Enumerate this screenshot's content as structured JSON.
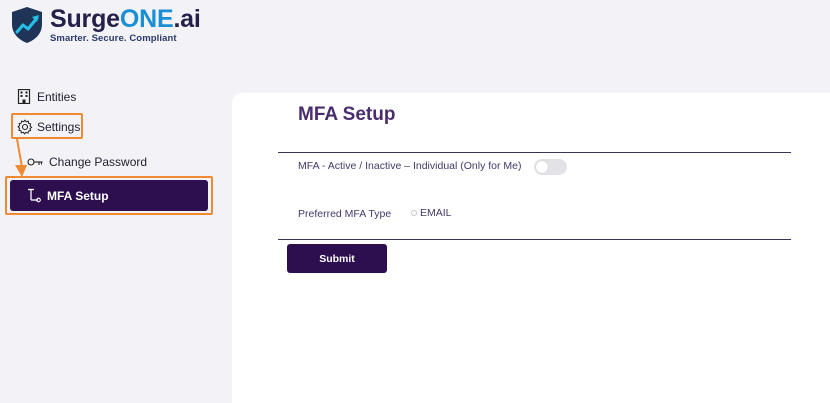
{
  "brand": {
    "name_part1": "Surge",
    "name_part2": "ONE",
    "name_part3": ".ai",
    "tagline": "Smarter. Secure. Compliant",
    "colors": {
      "dark": "#25204a",
      "accent": "#1a8fd6"
    }
  },
  "sidebar": {
    "items": [
      {
        "label": "Entities",
        "icon": "building-icon"
      },
      {
        "label": "Settings",
        "icon": "gear-icon"
      },
      {
        "label": "Change Password",
        "icon": "key-icon"
      },
      {
        "label": "MFA Setup",
        "icon": "mfa-icon",
        "active": true
      }
    ],
    "highlight_color": "#f08a32",
    "active_color": "#2d0f4f"
  },
  "main": {
    "title": "MFA Setup",
    "mfa_toggle_label": "MFA - Active / Inactive – Individual (Only for Me)",
    "mfa_toggle_on": false,
    "preferred_type_label": "Preferred MFA Type",
    "preferred_type_option": "EMAIL",
    "submit_label": "Submit"
  }
}
